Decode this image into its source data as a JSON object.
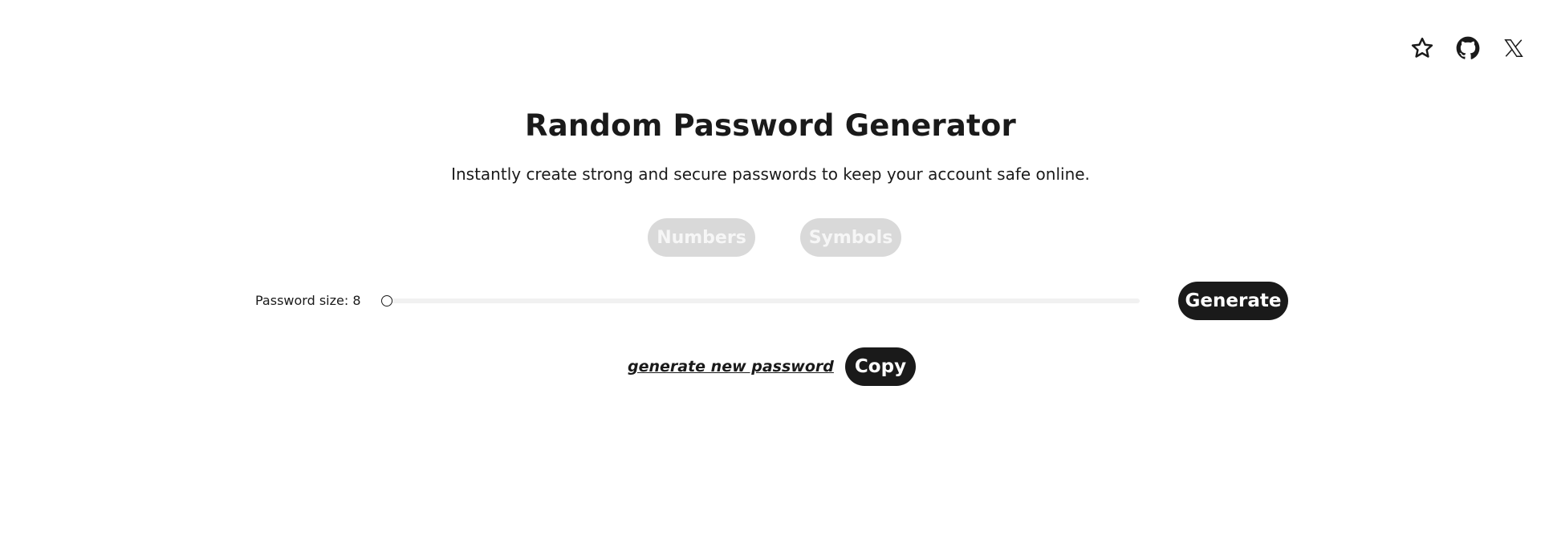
{
  "header": {
    "icons": [
      "star-icon",
      "github-icon",
      "x-logo-icon"
    ]
  },
  "main": {
    "title": "Random Password Generator",
    "subtitle": "Instantly create strong and secure passwords to keep your account safe online.",
    "options": {
      "numbers_label": "Numbers",
      "symbols_label": "Symbols",
      "numbers_enabled": false,
      "symbols_enabled": false
    },
    "size": {
      "label": "Password size: 8",
      "value": 8
    },
    "generate_label": "Generate",
    "password_output": "generate new password",
    "copy_label": "Copy"
  },
  "colors": {
    "dark": "#1a1a1a",
    "pill_inactive_bg": "#d9d9d9",
    "pill_inactive_text": "#f6f6f6",
    "track": "#f1f1f1"
  }
}
